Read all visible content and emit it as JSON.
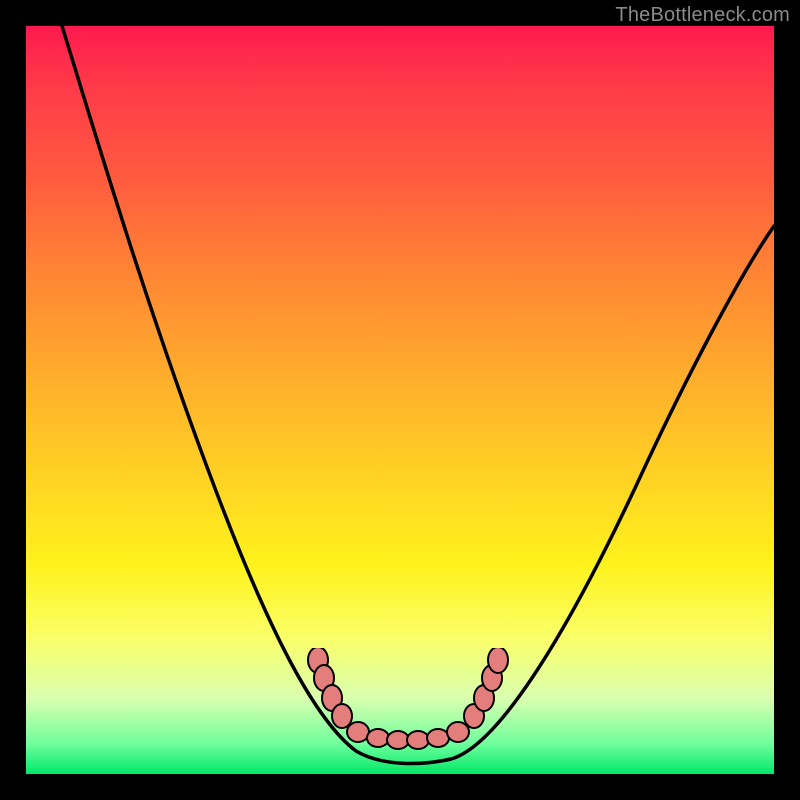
{
  "credit": "TheBottleneck.com",
  "colors": {
    "frame": "#000000",
    "gradient_top": "#ff1a4e",
    "gradient_mid": "#fff21c",
    "gradient_bottom": "#00e869",
    "curve": "#000000",
    "marker_fill": "#e37e7c",
    "marker_stroke": "#000000"
  },
  "chart_data": {
    "type": "line",
    "title": "",
    "xlabel": "",
    "ylabel": "",
    "xlim": [
      0,
      100
    ],
    "ylim": [
      0,
      100
    ],
    "note": "U/V shaped bottleneck curve; minimum ≈0 around x≈47–58; left branch reaches 100 at x≈5, right branch ≈63 at x≈100. Values estimated from pixels.",
    "series": [
      {
        "name": "bottleneck-curve",
        "x": [
          5,
          8,
          12,
          16,
          20,
          24,
          28,
          32,
          36,
          40,
          44,
          47,
          50,
          55,
          58,
          62,
          66,
          70,
          75,
          80,
          85,
          90,
          95,
          100
        ],
        "y": [
          100,
          90,
          78,
          66,
          56,
          46,
          37,
          29,
          22,
          15,
          8,
          2,
          0,
          0,
          2,
          7,
          12,
          18,
          25,
          32,
          40,
          48,
          55,
          63
        ]
      }
    ],
    "markers": {
      "name": "highlight-dots",
      "points": [
        {
          "x": 40,
          "y": 14
        },
        {
          "x": 41,
          "y": 11
        },
        {
          "x": 42,
          "y": 8
        },
        {
          "x": 44,
          "y": 4
        },
        {
          "x": 46,
          "y": 1
        },
        {
          "x": 48,
          "y": 0
        },
        {
          "x": 50,
          "y": 0
        },
        {
          "x": 52,
          "y": 0
        },
        {
          "x": 54,
          "y": 0
        },
        {
          "x": 56,
          "y": 0
        },
        {
          "x": 58,
          "y": 1
        },
        {
          "x": 60,
          "y": 4
        },
        {
          "x": 62,
          "y": 8
        },
        {
          "x": 63,
          "y": 11
        },
        {
          "x": 64,
          "y": 14
        }
      ]
    }
  }
}
